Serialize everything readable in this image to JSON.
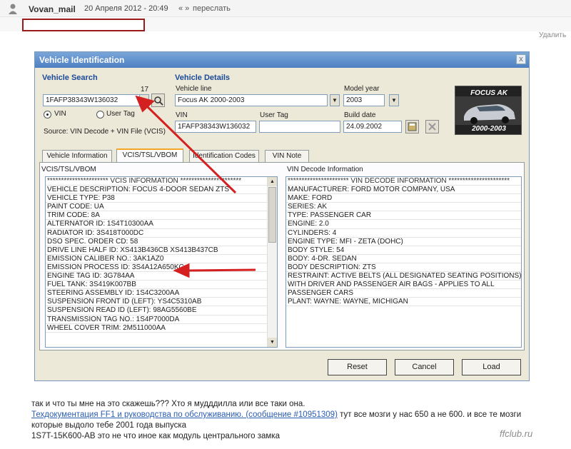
{
  "post": {
    "username": "Vovan_mail",
    "date": "20 Апреля 2012 - 20:49",
    "nav": "« »",
    "forward": "переслать",
    "delete": "Удалить"
  },
  "dialog": {
    "title": "Vehicle Identification",
    "close": "x",
    "vehicle_search": {
      "title": "Vehicle Search",
      "count": "17",
      "vin_value": "1FAFP38343W136032",
      "radio_vin": "VIN",
      "radio_user_tag": "User Tag",
      "source": "Source: VIN Decode + VIN File (VCIS)"
    },
    "vehicle_details": {
      "title": "Vehicle Details",
      "vehicle_line_label": "Vehicle line",
      "vehicle_line_value": "Focus AK 2000-2003",
      "model_year_label": "Model year",
      "model_year_value": "2003",
      "vin_label": "VIN",
      "vin_value": "1FAFP38343W136032",
      "user_tag_label": "User Tag",
      "user_tag_value": "",
      "build_date_label": "Build date",
      "build_date_value": "24.09.2002"
    },
    "car_image": {
      "title": "FOCUS AK",
      "years": "2000-2003"
    },
    "tabs": [
      "Vehicle Information",
      "VCIS/TSL/VBOM",
      "Identification Codes",
      "VIN Note"
    ],
    "left_pane": {
      "heading": "VCIS/TSL/VBOM",
      "rows": [
        "********************** VCIS INFORMATION **********************",
        "VEHICLE DESCRIPTION:  FOCUS 4-DOOR SEDAN ZTS",
        "VEHICLE TYPE:  P38",
        "PAINT CODE:  UA",
        "TRIM CODE:  8A",
        "ALTERNATOR ID:  1S4T10300AA",
        "RADIATOR ID:  3S418T000DC",
        "DSO SPEC. ORDER CD:  58",
        "DRIVE LINE HALF ID:  XS413B436CB      XS413B437CB",
        "EMISSION CALIBER NO.:  3AK1AZ0",
        "EMISSION PROCESS ID:  3S4A12A650KC",
        "ENGINE TAG ID:  3G784AA",
        "FUEL TANK:  3S419K007BB",
        "STEERING ASSEMBLY ID:  1S4C3200AA",
        "SUSPENSION FRONT ID (LEFT):  YS4C5310AB",
        "SUSPENSION READ ID (LEFT):  98AG5560BE",
        "TRANSMISSION TAG NO.:  1S4P7000DA",
        "WHEEL COVER TRIM:  2M511000AA"
      ]
    },
    "right_pane": {
      "heading": "VIN Decode Information",
      "rows": [
        "********************** VIN DECODE INFORMATION **********************",
        "MANUFACTURER: FORD MOTOR COMPANY, USA",
        "MAKE: FORD",
        "SERIES: AK",
        "TYPE: PASSENGER CAR",
        "ENGINE: 2.0",
        "CYLINDERS: 4",
        "ENGINE TYPE: MFI - ZETA (DOHC)",
        "BODY STYLE: 54",
        "BODY: 4-DR. SEDAN",
        "BODY DESCRIPTION: ZTS",
        "RESTRAINT: ACTIVE BELTS (ALL DESIGNATED SEATING POSITIONS)",
        "WITH DRIVER AND PASSENGER AIR BAGS - APPLIES TO ALL",
        "PASSENGER CARS",
        "PLANT: WAYNE: WAYNE, MICHIGAN"
      ]
    },
    "buttons": {
      "reset": "Reset",
      "cancel": "Cancel",
      "load": "Load"
    }
  },
  "message": {
    "line1": "так и что ты мне на это скажешь??? Хто я мудддилла или все таки она.",
    "link": "Техдокументация FF1 и руководства по обслуживанию. (сообщение #10951309)",
    "line2_rest": " тут все мозги у нас 650 а не 600. и все те мозги",
    "line3": "которые выдоло тебе 2001 года выпуска",
    "line4": "1S7T-15K600-AB это не что иное как модуль центрального замка"
  },
  "watermark": "ffclub.ru",
  "colors": {
    "arrow": "#d42020",
    "title_bar": "#4d7fc2",
    "group_title": "#1a4a9a"
  }
}
